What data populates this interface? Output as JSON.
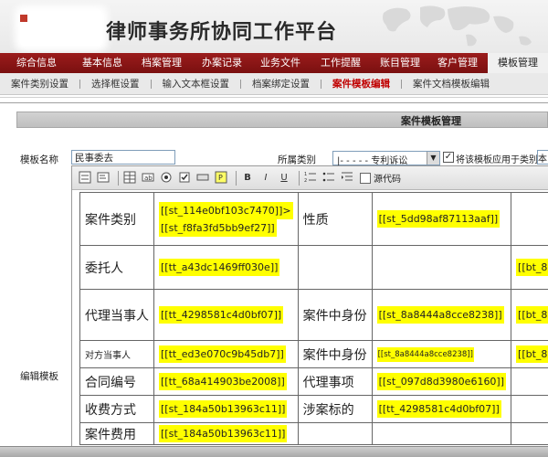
{
  "header": {
    "title": "律师事务所协同工作平台"
  },
  "main_nav": {
    "items": [
      {
        "label": "综合信息",
        "active": false
      },
      {
        "label": "基本信息",
        "active": false
      },
      {
        "label": "档案管理",
        "active": false
      },
      {
        "label": "办案记录",
        "active": false
      },
      {
        "label": "业务文件",
        "active": false
      },
      {
        "label": "工作提醒",
        "active": false
      },
      {
        "label": "账目管理",
        "active": false
      },
      {
        "label": "客户管理",
        "active": false
      },
      {
        "label": "模板管理",
        "active": true
      }
    ]
  },
  "sub_nav": {
    "items": [
      {
        "label": "案件类别设置",
        "active": false
      },
      {
        "label": "选择框设置",
        "active": false
      },
      {
        "label": "输入文本框设置",
        "active": false
      },
      {
        "label": "档案绑定设置",
        "active": false
      },
      {
        "label": "案件模板编辑",
        "active": true
      },
      {
        "label": "案件文档模板编辑",
        "active": false
      }
    ]
  },
  "section": {
    "title": "案件模板管理"
  },
  "form": {
    "name_label": "模板名称",
    "name_value": "民事委去",
    "category_label": "所属类别",
    "category_value": "|- - - - - 专利诉讼",
    "apply_checked": true,
    "apply_label": "将该模板应用于类别",
    "apply_select_value": "本",
    "editor_label": "编辑模板"
  },
  "toolbar": {
    "bold": "B",
    "italic": "I",
    "underline": "U",
    "source_label": "源代码",
    "icons": [
      "form-icon",
      "textarea-icon",
      "table-icon",
      "field-icon",
      "radio-icon",
      "checkbox-icon",
      "button-icon",
      "param-icon"
    ]
  },
  "template_table": {
    "rows": [
      {
        "cells": [
          {
            "type": "label",
            "text": "案件类别"
          },
          {
            "type": "tags",
            "tags": [
              "[[st_114e0bf103c7470]]>",
              "[[st_f8fa3fd5bb9ef27]]"
            ]
          },
          {
            "type": "label",
            "text": "性质"
          },
          {
            "type": "tags",
            "tags": [
              "[[st_5dd98af87113aaf]]"
            ]
          },
          {
            "type": "empty"
          }
        ]
      },
      {
        "cells": [
          {
            "type": "label",
            "text": "委托人"
          },
          {
            "type": "tags",
            "tags": [
              "[[tt_a43dc1469ff030e]]"
            ]
          },
          {
            "type": "empty"
          },
          {
            "type": "empty"
          },
          {
            "type": "tags",
            "tags": [
              "[[bt_8"
            ]
          }
        ]
      },
      {
        "cells": [
          {
            "type": "label",
            "text": "代理当事人"
          },
          {
            "type": "tags",
            "tags": [
              "[[tt_4298581c4d0bf07]]"
            ]
          },
          {
            "type": "label",
            "text": "案件中身份"
          },
          {
            "type": "tags",
            "tags": [
              "[[st_8a8444a8cce8238]]"
            ]
          },
          {
            "type": "tags",
            "tags": [
              "[[bt_8"
            ]
          }
        ]
      },
      {
        "cells": [
          {
            "type": "label",
            "text": "对方当事人",
            "small": true
          },
          {
            "type": "tags",
            "tags": [
              "[[tt_ed3e070c9b45db7]]"
            ]
          },
          {
            "type": "label",
            "text": "案件中身份"
          },
          {
            "type": "tags",
            "tags": [
              "[[st_8a8444a8cce8238]]"
            ],
            "tiny": true
          },
          {
            "type": "tags",
            "tags": [
              "[[bt_8"
            ]
          }
        ]
      },
      {
        "cells": [
          {
            "type": "label",
            "text": "合同编号"
          },
          {
            "type": "tags",
            "tags": [
              "[[tt_68a414903be2008]]"
            ]
          },
          {
            "type": "label",
            "text": "代理事项"
          },
          {
            "type": "tags",
            "tags": [
              "[[st_097d8d3980e6160]]"
            ]
          },
          {
            "type": "empty"
          }
        ]
      },
      {
        "cells": [
          {
            "type": "label",
            "text": "收费方式"
          },
          {
            "type": "tags",
            "tags": [
              "[[st_184a50b13963c11]]"
            ]
          },
          {
            "type": "label",
            "text": "涉案标的"
          },
          {
            "type": "tags",
            "tags": [
              "[[tt_4298581c4d0bf07]]"
            ]
          },
          {
            "type": "empty"
          }
        ]
      },
      {
        "cells": [
          {
            "type": "label",
            "text": "案件费用"
          },
          {
            "type": "tags",
            "tags": [
              "[[st_184a50b13963c11]]"
            ]
          },
          {
            "type": "empty"
          },
          {
            "type": "empty"
          },
          {
            "type": "empty"
          }
        ]
      }
    ]
  },
  "colors": {
    "nav_red": "#8b1515",
    "tag_yellow": "#ffff00",
    "active_sub": "#c00000"
  }
}
